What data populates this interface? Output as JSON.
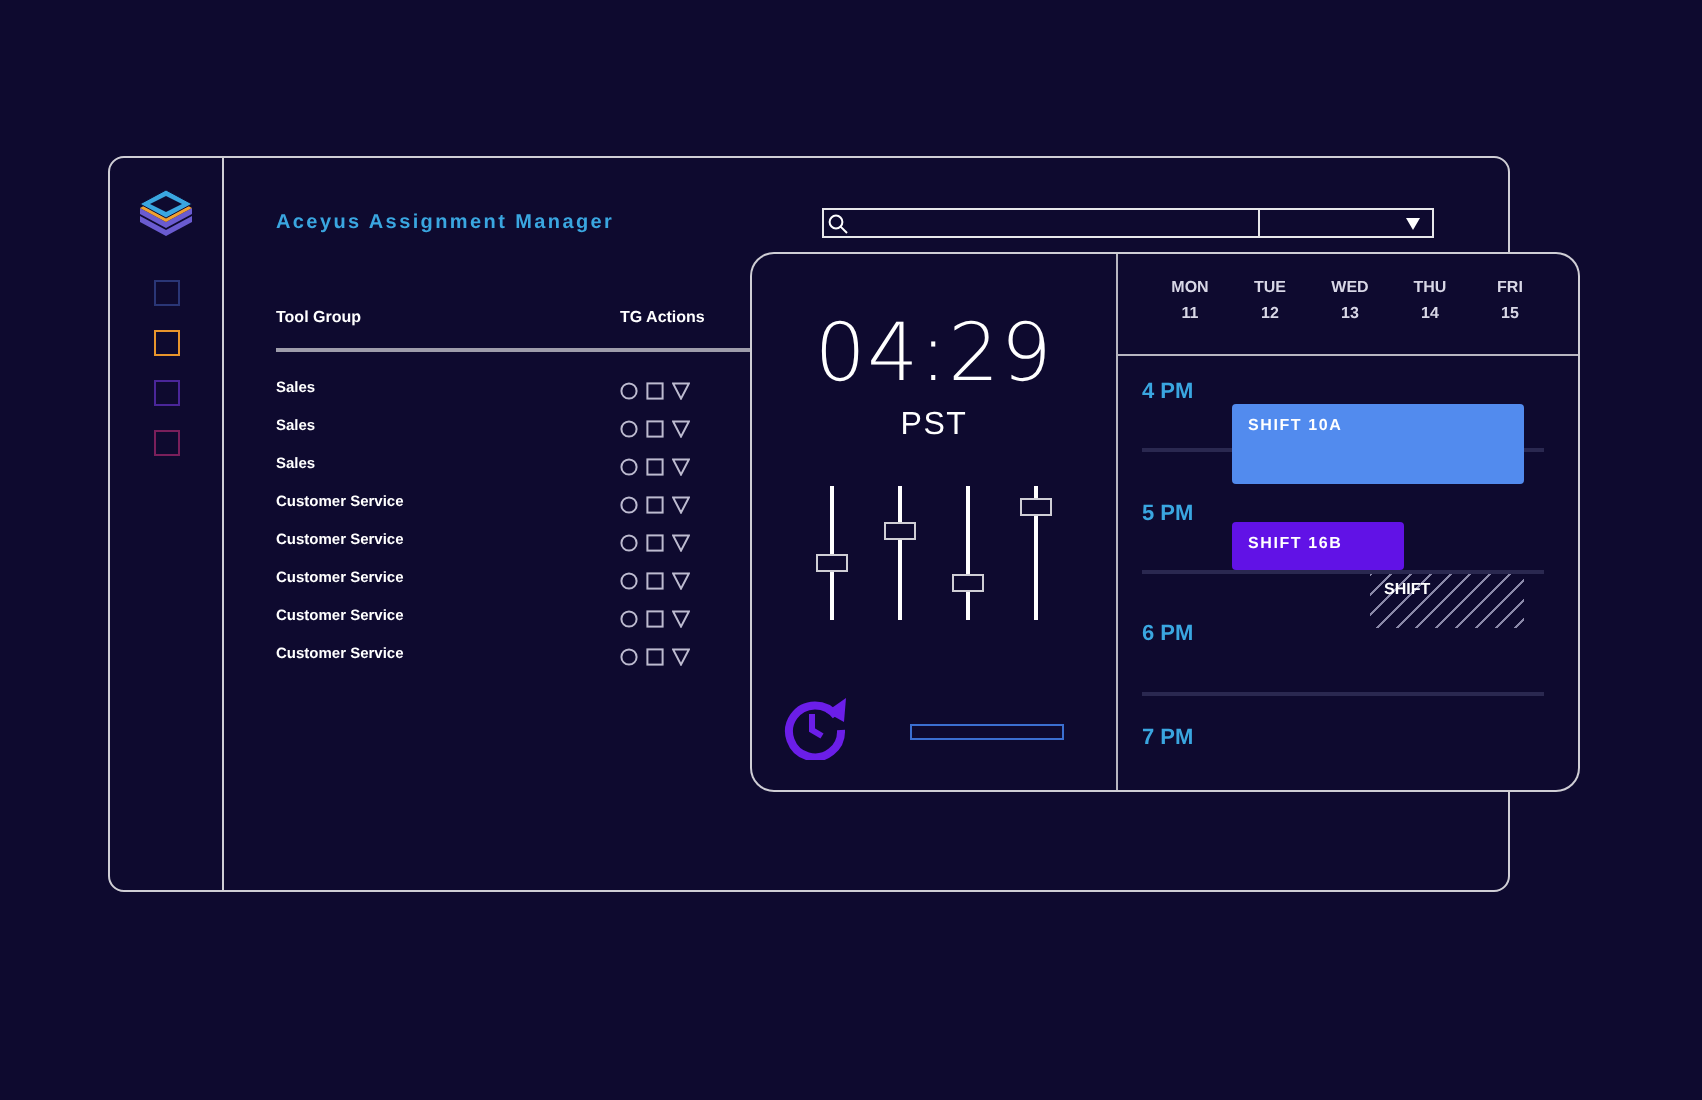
{
  "app": {
    "title": "Aceyus Assignment Manager"
  },
  "sidebar": {
    "items": [
      {
        "color": "#2a3676"
      },
      {
        "color": "#e8952c"
      },
      {
        "color": "#4a2699"
      },
      {
        "color": "#7a1f5b"
      }
    ]
  },
  "table": {
    "columns": [
      "Tool Group",
      "TG Actions"
    ],
    "rows": [
      {
        "tool_group": "Sales"
      },
      {
        "tool_group": "Sales"
      },
      {
        "tool_group": "Sales"
      },
      {
        "tool_group": "Customer Service"
      },
      {
        "tool_group": "Customer Service"
      },
      {
        "tool_group": "Customer Service"
      },
      {
        "tool_group": "Customer Service"
      },
      {
        "tool_group": "Customer Service"
      }
    ]
  },
  "clock": {
    "time": "04:29",
    "zone": "PST",
    "sliders": [
      {
        "level": 0.43
      },
      {
        "level": 0.66
      },
      {
        "level": 0.28
      },
      {
        "level": 0.85
      }
    ],
    "progress": {
      "level": 0
    }
  },
  "calendar": {
    "days": [
      {
        "day": "MON",
        "date": "11"
      },
      {
        "day": "TUE",
        "date": "12"
      },
      {
        "day": "WED",
        "date": "13"
      },
      {
        "day": "THU",
        "date": "14"
      },
      {
        "day": "FRI",
        "date": "15"
      }
    ],
    "hours": [
      "4 PM",
      "5 PM",
      "6 PM",
      "7 PM"
    ],
    "shifts": [
      {
        "label": "SHIFT 10A",
        "kind": "solid",
        "color": "#528bee"
      },
      {
        "label": "SHIFT 16B",
        "kind": "solid",
        "color": "#6112e6"
      },
      {
        "label": "SHIFT",
        "kind": "hatched",
        "color": "#8a88a8"
      }
    ]
  }
}
